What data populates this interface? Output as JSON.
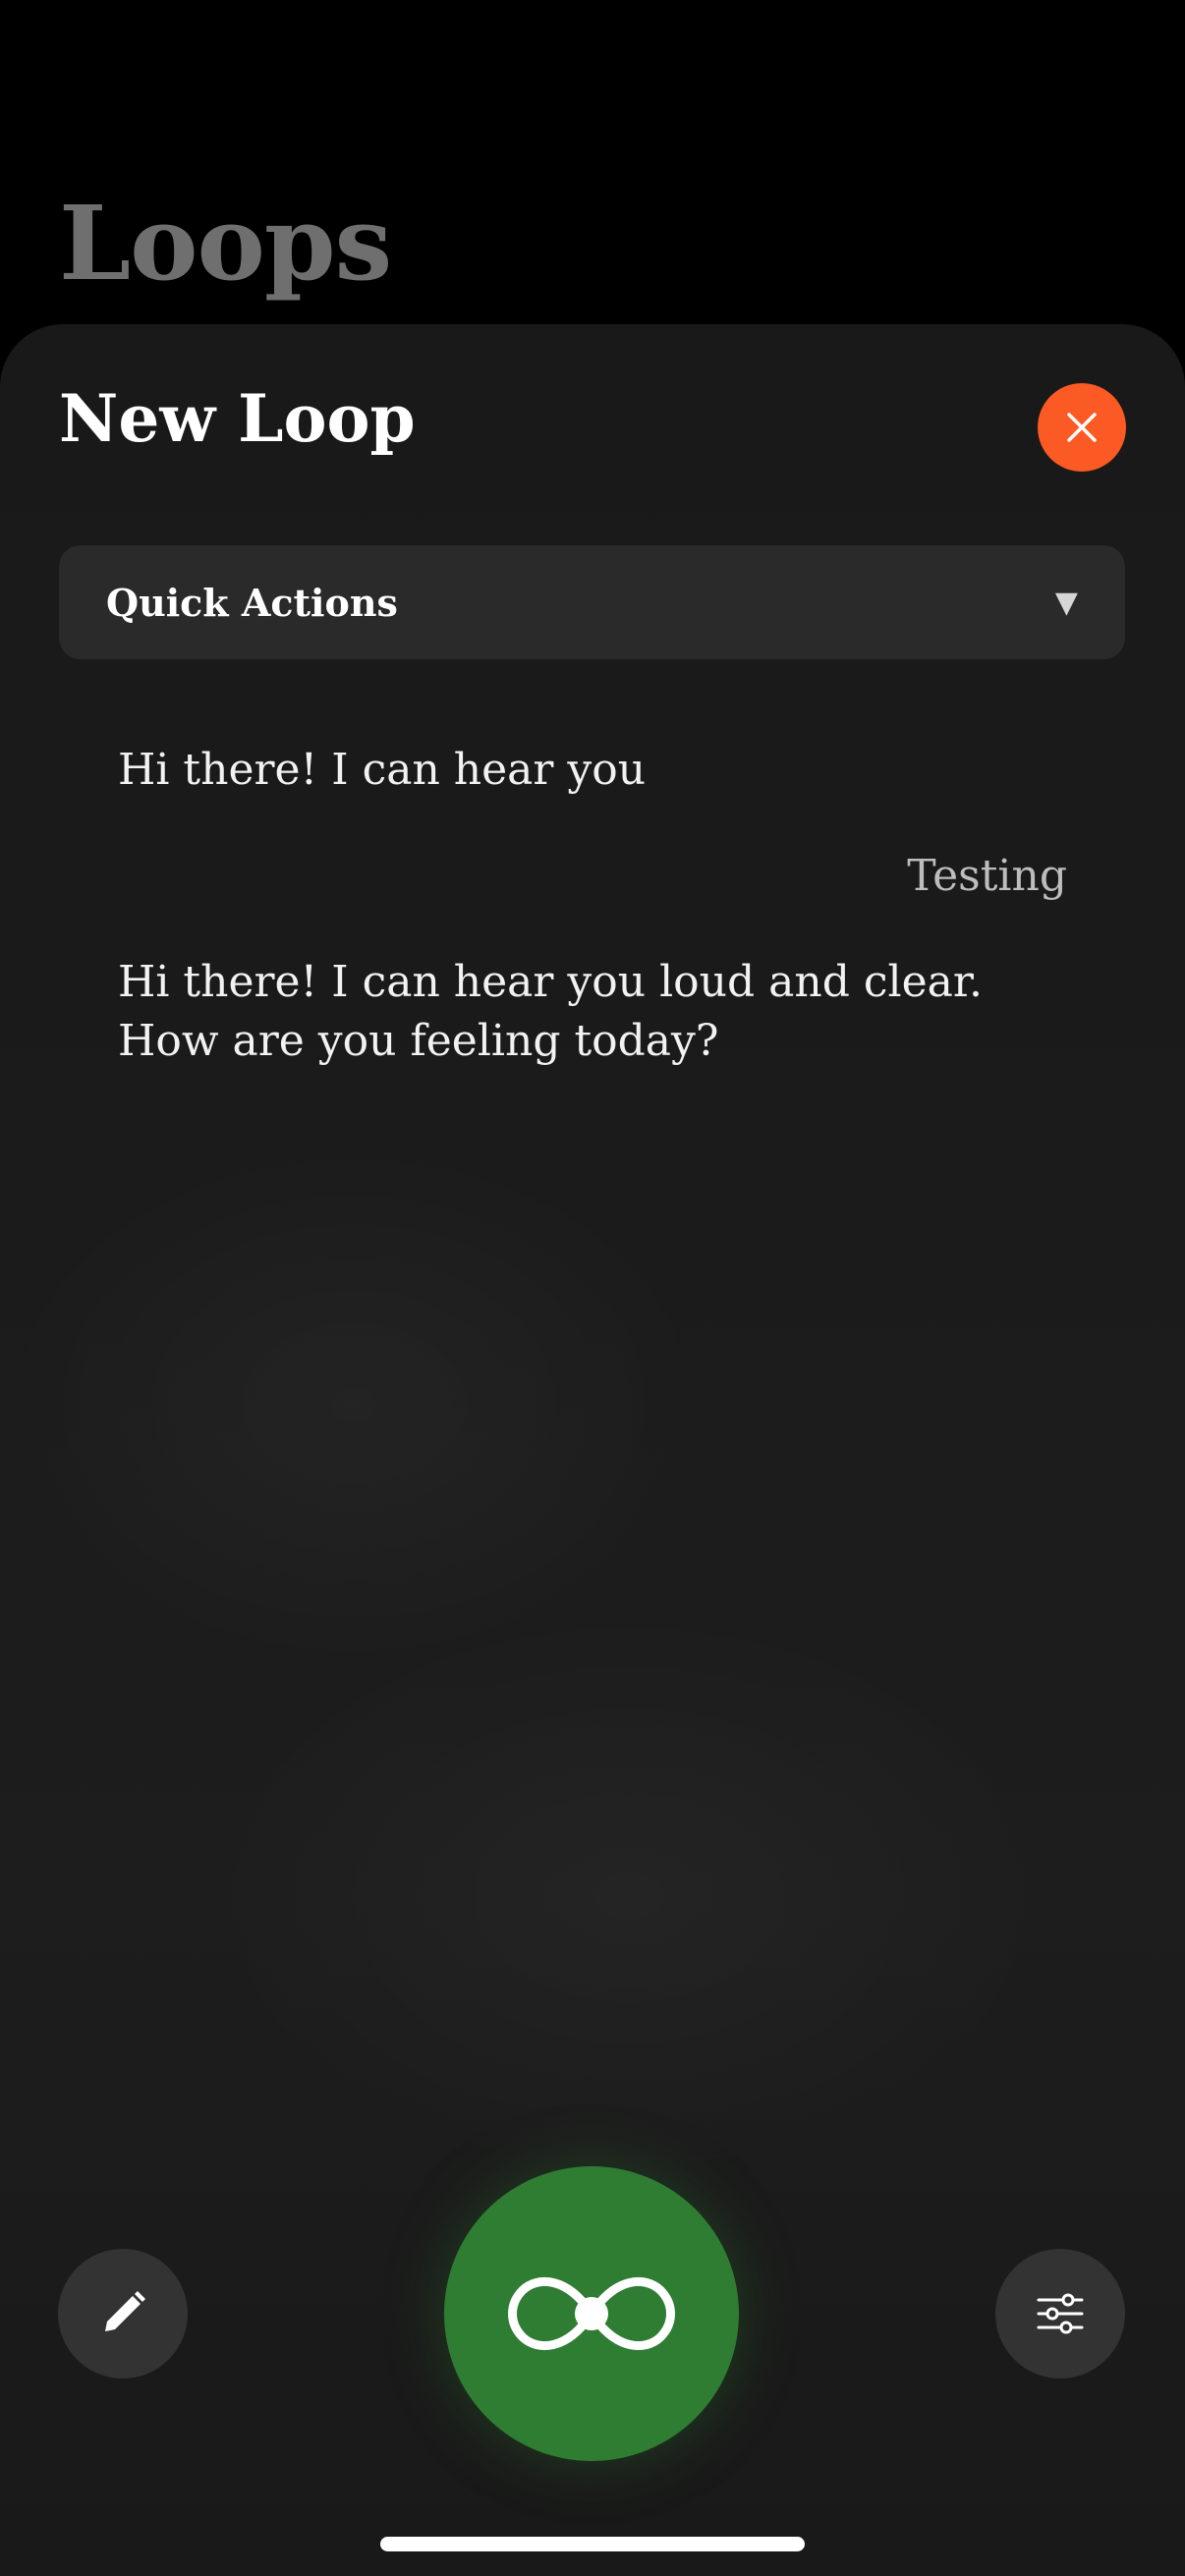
{
  "background_screen": {
    "title": "Loops"
  },
  "sheet": {
    "title": "New Loop",
    "close_icon": "close-icon",
    "quick_actions": {
      "label": "Quick Actions",
      "caret": "▼"
    }
  },
  "messages": [
    {
      "text": "Hi there! I can hear you",
      "role": "assistant"
    },
    {
      "text": "Testing",
      "role": "user"
    },
    {
      "text": "Hi there! I can hear you loud and clear. How are you feeling today?",
      "role": "assistant"
    }
  ],
  "toolbar": {
    "edit_icon": "pencil-icon",
    "main_icon": "loop-infinity-icon",
    "settings_icon": "sliders-icon"
  },
  "colors": {
    "accent_close": "#fb5a24",
    "main_button": "#2e7d32",
    "sheet_bg": "#1b1b1b"
  }
}
